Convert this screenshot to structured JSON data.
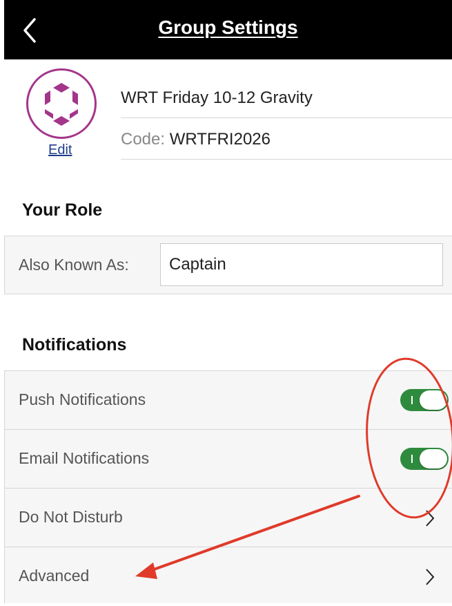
{
  "header": {
    "title": "Group Settings",
    "back_icon": "chevron-left-icon"
  },
  "group": {
    "name": "WRT Friday 10-12 Gravity",
    "code_label": "Code:",
    "code_value": "WRTFRI2026",
    "edit_label": "Edit",
    "avatar_icon": "group-hexagon-icon"
  },
  "role": {
    "section_title": "Your Role",
    "aka_label": "Also Known As:",
    "aka_value": "Captain"
  },
  "notifications": {
    "section_title": "Notifications",
    "items": [
      {
        "label": "Push Notifications",
        "control": "toggle",
        "on": true
      },
      {
        "label": "Email Notifications",
        "control": "toggle",
        "on": true
      },
      {
        "label": "Do Not Disturb",
        "control": "chevron"
      },
      {
        "label": "Advanced",
        "control": "chevron"
      }
    ]
  },
  "colors": {
    "header_bg": "#000000",
    "toggle_on": "#2e8b3e",
    "avatar_accent": "#a3358a",
    "link": "#1d3c8c",
    "annotation": "#e03a2a"
  }
}
